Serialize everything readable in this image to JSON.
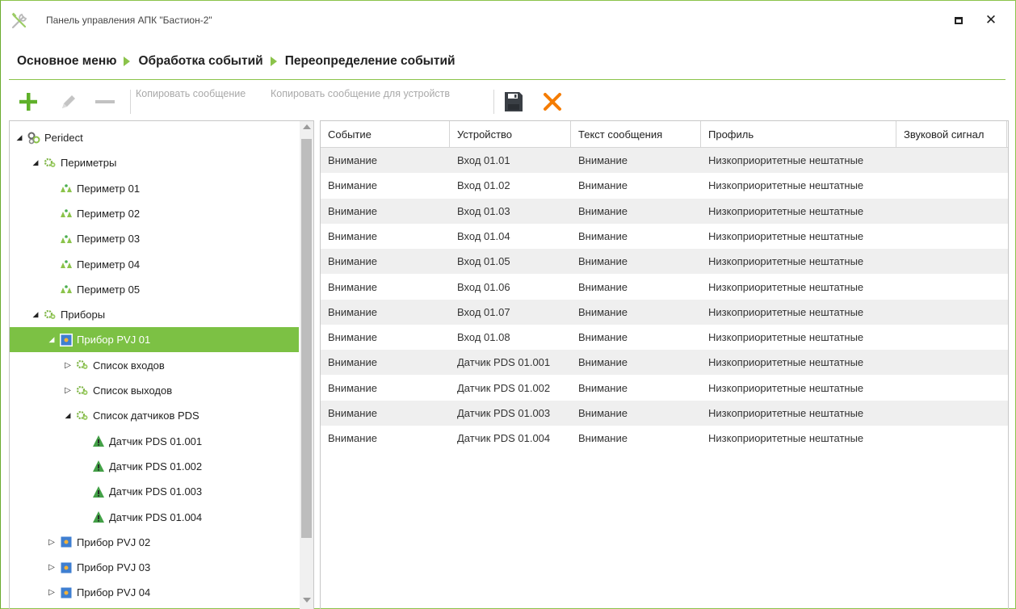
{
  "window": {
    "title": "Панель управления АПК \"Бастион-2\""
  },
  "breadcrumb": [
    "Основное меню",
    "Обработка событий",
    "Переопределение событий"
  ],
  "toolbar": {
    "copy_message": "Копировать сообщение",
    "copy_message_devices": "Копировать сообщение для устройств"
  },
  "colors": {
    "accent": "#8bc34a",
    "selection": "#7cc144",
    "cancel": "#f57c00",
    "disabled_text": "#a9a9a9"
  },
  "tree": {
    "nodes": [
      {
        "label": "Peridect",
        "level": 0,
        "state": "expanded",
        "icon": "gear-cluster-icon"
      },
      {
        "label": "Периметры",
        "level": 1,
        "state": "expanded",
        "icon": "gears-icon"
      },
      {
        "label": "Периметр 01",
        "level": 2,
        "state": "leaf",
        "icon": "perimeter-icon"
      },
      {
        "label": "Периметр 02",
        "level": 2,
        "state": "leaf",
        "icon": "perimeter-icon"
      },
      {
        "label": "Периметр 03",
        "level": 2,
        "state": "leaf",
        "icon": "perimeter-icon"
      },
      {
        "label": "Периметр 04",
        "level": 2,
        "state": "leaf",
        "icon": "perimeter-icon"
      },
      {
        "label": "Периметр 05",
        "level": 2,
        "state": "leaf",
        "icon": "perimeter-icon"
      },
      {
        "label": "Приборы",
        "level": 1,
        "state": "expanded",
        "icon": "gears-icon"
      },
      {
        "label": "Прибор PVJ 01",
        "level": 2,
        "state": "expanded",
        "icon": "device-icon",
        "selected": true
      },
      {
        "label": "Список входов",
        "level": 3,
        "state": "collapsed",
        "icon": "gears-icon"
      },
      {
        "label": "Список выходов",
        "level": 3,
        "state": "collapsed",
        "icon": "gears-icon"
      },
      {
        "label": "Список датчиков PDS",
        "level": 3,
        "state": "expanded",
        "icon": "gears-icon"
      },
      {
        "label": "Датчик PDS 01.001",
        "level": 4,
        "state": "leaf",
        "icon": "warning-icon"
      },
      {
        "label": "Датчик PDS 01.002",
        "level": 4,
        "state": "leaf",
        "icon": "warning-icon"
      },
      {
        "label": "Датчик PDS 01.003",
        "level": 4,
        "state": "leaf",
        "icon": "warning-icon"
      },
      {
        "label": "Датчик PDS 01.004",
        "level": 4,
        "state": "leaf",
        "icon": "warning-icon"
      },
      {
        "label": "Прибор PVJ 02",
        "level": 2,
        "state": "collapsed",
        "icon": "device-icon"
      },
      {
        "label": "Прибор PVJ 03",
        "level": 2,
        "state": "collapsed",
        "icon": "device-icon"
      },
      {
        "label": "Прибор PVJ 04",
        "level": 2,
        "state": "collapsed",
        "icon": "device-icon"
      }
    ]
  },
  "grid": {
    "columns": [
      "Событие",
      "Устройство",
      "Текст сообщения",
      "Профиль",
      "Звуковой сигнал"
    ],
    "rows": [
      [
        "Внимание",
        "Вход 01.01",
        "Внимание",
        "Низкоприоритетные нештатные",
        ""
      ],
      [
        "Внимание",
        "Вход 01.02",
        "Внимание",
        "Низкоприоритетные нештатные",
        ""
      ],
      [
        "Внимание",
        "Вход 01.03",
        "Внимание",
        "Низкоприоритетные нештатные",
        ""
      ],
      [
        "Внимание",
        "Вход 01.04",
        "Внимание",
        "Низкоприоритетные нештатные",
        ""
      ],
      [
        "Внимание",
        "Вход 01.05",
        "Внимание",
        "Низкоприоритетные нештатные",
        ""
      ],
      [
        "Внимание",
        "Вход 01.06",
        "Внимание",
        "Низкоприоритетные нештатные",
        ""
      ],
      [
        "Внимание",
        "Вход 01.07",
        "Внимание",
        "Низкоприоритетные нештатные",
        ""
      ],
      [
        "Внимание",
        "Вход 01.08",
        "Внимание",
        "Низкоприоритетные нештатные",
        ""
      ],
      [
        "Внимание",
        "Датчик PDS 01.001",
        "Внимание",
        "Низкоприоритетные нештатные",
        ""
      ],
      [
        "Внимание",
        "Датчик PDS 01.002",
        "Внимание",
        "Низкоприоритетные нештатные",
        ""
      ],
      [
        "Внимание",
        "Датчик PDS 01.003",
        "Внимание",
        "Низкоприоритетные нештатные",
        ""
      ],
      [
        "Внимание",
        "Датчик PDS 01.004",
        "Внимание",
        "Низкоприоритетные нештатные",
        ""
      ]
    ]
  }
}
